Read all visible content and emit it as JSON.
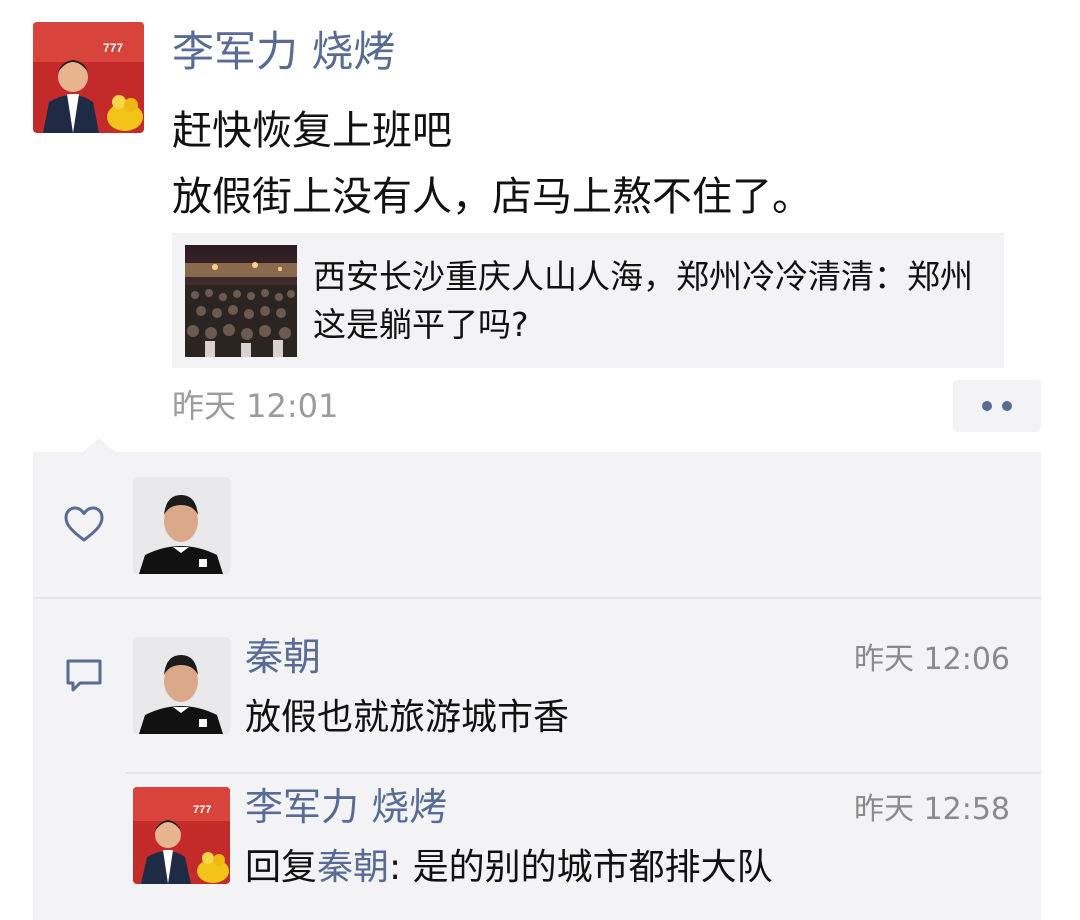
{
  "post": {
    "author": "李军力 烧烤",
    "text_lines": [
      "赶快恢复上班吧",
      "放假街上没有人，店马上熬不住了。"
    ],
    "shared_article_title": "西安长沙重庆人山人海，郑州冷冷清清：郑州这是躺平了吗?",
    "time": "昨天 12:01"
  },
  "likes": {
    "icon": "heart-icon"
  },
  "comments": [
    {
      "name": "秦朝",
      "time": "昨天 12:06",
      "text": "放假也就旅游城市香"
    },
    {
      "name": "李军力 烧烤",
      "time": "昨天 12:58",
      "reply_prefix": "回复",
      "reply_to": "秦朝",
      "text": ": 是的别的城市都排大队"
    }
  ],
  "colors": {
    "name_blue": "#576b95",
    "panel_bg": "#f3f3f5",
    "time_gray": "#9b9b9b"
  }
}
